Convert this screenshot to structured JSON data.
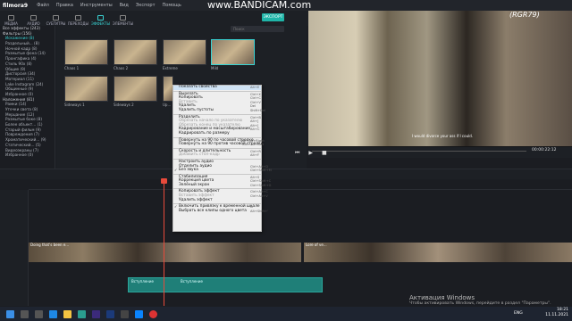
{
  "app": {
    "title": "filmora9",
    "menu": [
      "Файл",
      "Правка",
      "Инструменты",
      "Вид",
      "Экспорт",
      "Помощь"
    ],
    "watermark": "www.BANDICAM.com",
    "tag": "(RGR79)"
  },
  "tabs": [
    {
      "label": "МЕДИА"
    },
    {
      "label": "АУДИО"
    },
    {
      "label": "СУБТИТРЫ"
    },
    {
      "label": "ПЕРЕХОДЫ"
    },
    {
      "label": "ЭФФЕКТЫ"
    },
    {
      "label": "ЭЛЕМЕНТЫ"
    }
  ],
  "export_label": "ЭКСПОРТ",
  "search_placeholder": "Поиск",
  "sidebar": [
    "Все эффекты (243)",
    "Фильтры (156)",
    "Искажение (8)",
    "Раздельный... (8)",
    "Ночной кадр (8)",
    "Размытые фона (14)",
    "Пронгафика (4)",
    "Стиль 90x (8)",
    "Общие (9)",
    "Дисторсия (34)",
    "Материал (11)",
    "Lake Instagram (24)",
    "Общинные (9)",
    "Избранное (0)",
    "Наложения (81)",
    "Рамки (14)",
    "Утечки света (8)",
    "Мерцание (12)",
    "Размытые боке (8)",
    "Более объект... (1)",
    "Старый фильм (9)",
    "Повреждения (7)",
    "Хроматический... (9)",
    "Статический... (5)",
    "Видеоэкраны (7)",
    "Избранное (0)"
  ],
  "thumbs": [
    {
      "label": "Chaos 1"
    },
    {
      "label": "Chaos 2"
    },
    {
      "label": "Extreme"
    },
    {
      "label": "Mild"
    },
    {
      "label": "Sideways 1"
    },
    {
      "label": "Sideways 2"
    },
    {
      "label": "Up..."
    }
  ],
  "context_menu": [
    {
      "label": "Показать свойства",
      "sc": "Alt+E",
      "dis": false,
      "hl": true
    },
    {
      "label": "Вырезать",
      "sc": "Ctrl+X"
    },
    {
      "label": "Копировать",
      "sc": "Ctrl+C"
    },
    {
      "label": "Вставить",
      "sc": "Ctrl+V",
      "dis": true
    },
    {
      "label": "Удалить",
      "sc": "Del"
    },
    {
      "label": "Удалить пустоты",
      "sc": "Shift+Del"
    },
    {
      "label": "Разделить",
      "sc": "Ctrl+B"
    },
    {
      "label": "Обрезать начало по указателю",
      "sc": "Alt+[",
      "dis": true
    },
    {
      "label": "Обрезать конец по указателю",
      "sc": "Alt+]",
      "dis": true
    },
    {
      "label": "Кадрирование и масштабирование",
      "sc": "Alt+C"
    },
    {
      "label": "Кадрировать по размеру",
      "sc": ""
    },
    {
      "label": "Повернуть на 90 по часовой стрелке",
      "sc": "Ctrl+Alt+Right"
    },
    {
      "label": "Повернуть на 90 против часовой стрелки",
      "sc": "Ctrl+Alt+Left"
    },
    {
      "label": "Скорость и длительность",
      "sc": "Ctrl+R"
    },
    {
      "label": "Добавить стоп-кадр",
      "sc": "Alt+F",
      "dis": true
    },
    {
      "label": "Настроить аудио",
      "sc": ""
    },
    {
      "label": "Отделить аудио",
      "sc": "Ctrl+Alt+D"
    },
    {
      "label": "Без звука",
      "sc": "Ctrl+Shift+M",
      "chk": "✓"
    },
    {
      "label": "Стабилизация",
      "sc": "Alt+S"
    },
    {
      "label": "Коррекция цвета",
      "sc": "Ctrl+Shift+C"
    },
    {
      "label": "Зелёный экран",
      "sc": "Ctrl+Shift+G"
    },
    {
      "label": "Копировать эффект",
      "sc": "Ctrl+Alt+C"
    },
    {
      "label": "Вставить эффект",
      "sc": "Ctrl+Alt+V",
      "dis": true
    },
    {
      "label": "Удалить эффект",
      "sc": ""
    },
    {
      "label": "Включить привязку к временной шкале",
      "sc": "N",
      "chk": "✓"
    },
    {
      "label": "Выбрать все клипы одного цвета",
      "sc": "Alt+Shift+'"
    }
  ],
  "subtitle": "I would divorce your ass if I could.",
  "timecode": "00:00:22:12",
  "clips": {
    "video1": "Doing that's been e...",
    "video2": "Lore of ve...",
    "audio": "Вступление",
    "audio2": "Вступление"
  },
  "activate": {
    "t1": "Активация Windows",
    "t2": "Чтобы активировать Windows, перейдите в раздел \"Параметры\"."
  },
  "clock": {
    "time": "18:21",
    "date": "11.11.2021",
    "lang": "ENG"
  }
}
